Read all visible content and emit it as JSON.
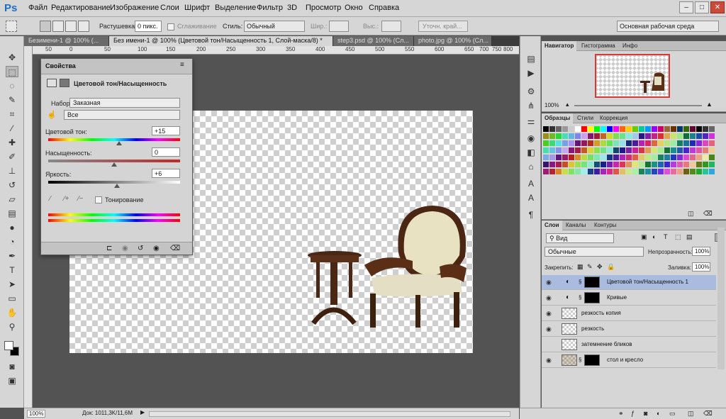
{
  "app": {
    "logo": "Ps"
  },
  "menu": [
    "Файл",
    "Редактирование",
    "Изображение",
    "Слои",
    "Шрифт",
    "Выделение",
    "Фильтр",
    "3D",
    "Просмотр",
    "Окно",
    "Справка"
  ],
  "window_buttons": {
    "minimize": "–",
    "maximize": "□",
    "close": "✕"
  },
  "options": {
    "feather_label": "Растушевка:",
    "feather_value": "0 пикс.",
    "antialias_label": "Сглаживание",
    "style_label": "Стиль:",
    "style_value": "Обычный",
    "width_label": "Шир.:",
    "height_label": "Выс.:",
    "refine_button": "Уточн. край...",
    "workspace": "Основная рабочая среда"
  },
  "tabs": [
    {
      "label": "Безимени-1 @ 100% (...",
      "active": false
    },
    {
      "label": "Без имени-1 @ 100% (Цветовой тон/Насыщенность 1, Слой-маска/8) *",
      "active": true
    },
    {
      "label": "step3.psd @ 100% (Сл...",
      "active": false
    },
    {
      "label": "photo.jpg @ 100% (Сл...",
      "active": false
    }
  ],
  "ruler_ticks": [
    "50",
    "0",
    "50",
    "100",
    "150",
    "200",
    "250",
    "300",
    "350",
    "400",
    "450",
    "500",
    "550",
    "600",
    "650",
    "700",
    "750",
    "800"
  ],
  "properties": {
    "tab": "Свойства",
    "title": "Цветовой тон/Насыщенность",
    "preset_label": "Набор:",
    "preset_value": "Заказная",
    "channel_value": "Все",
    "hue_label": "Цветовой тон:",
    "hue_value": "+15",
    "hue_level": 0.54,
    "saturation_label": "Насыщенность:",
    "saturation_value": "0",
    "saturation_level": 0.5,
    "lightness_label": "Яркость:",
    "lightness_value": "+6",
    "lightness_level": 0.52,
    "colorize_label": "Тонирование"
  },
  "navigator": {
    "tabs": [
      "Навигатор",
      "Гистограмма",
      "Инфо"
    ],
    "zoom": "100%"
  },
  "swatches_panel": {
    "tabs": [
      "Образцы",
      "Стили",
      "Коррекция"
    ]
  },
  "layers_panel": {
    "tabs": [
      "Слои",
      "Каналы",
      "Контуры"
    ],
    "filter": "Вид",
    "blend_mode": "Обычные",
    "opacity_label": "Непрозрачность:",
    "opacity_value": "100%",
    "lock_label": "Закрепить:",
    "fill_label": "Заливка:",
    "fill_value": "100%",
    "layers": [
      {
        "name": "Цветовой тон/Насыщенность 1",
        "type": "adjustment",
        "selected": true
      },
      {
        "name": "Кривые",
        "type": "adjustment",
        "selected": false
      },
      {
        "name": "резкость копия",
        "type": "pixel",
        "selected": false
      },
      {
        "name": "резкость",
        "type": "pixel",
        "selected": false
      },
      {
        "name": "затемнение бликов",
        "type": "pixel",
        "selected": false
      },
      {
        "name": "стол и кресло",
        "type": "masked",
        "selected": false
      }
    ]
  },
  "status": {
    "zoom": "100%",
    "doc": "Док: 1011,3K/11,6M"
  }
}
